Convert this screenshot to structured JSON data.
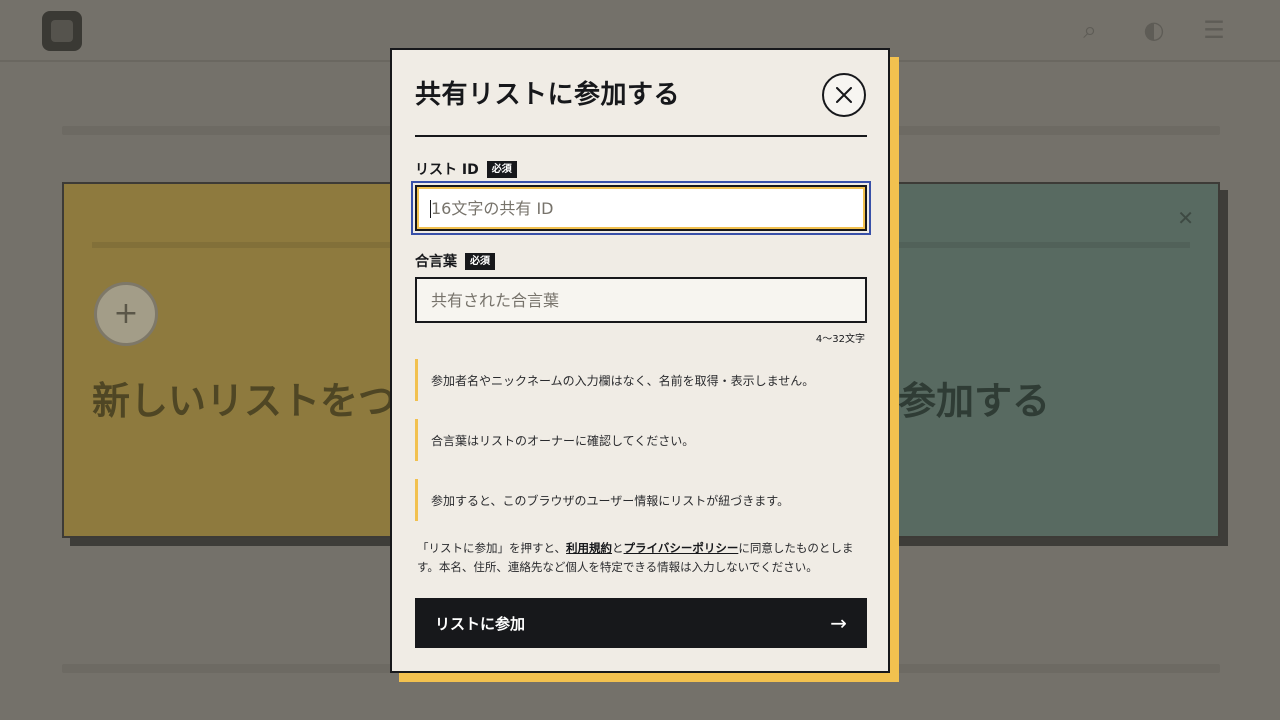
{
  "modal": {
    "title": "共有リストに参加する",
    "close_label": "閉じる",
    "list_id": {
      "label": "リスト ID",
      "required_badge": "必須",
      "placeholder": "16文字の共有 ID",
      "value": ""
    },
    "passphrase": {
      "label": "合言葉",
      "required_badge": "必須",
      "placeholder": "共有された合言葉",
      "value": "",
      "length_hint": "4〜32文字"
    },
    "notices": [
      "参加者名やニックネームの入力欄はなく、名前を取得・表示しません。",
      "合言葉はリストのオーナーに確認してください。",
      "参加すると、このブラウザのユーザー情報にリストが紐づきます。"
    ],
    "legal": {
      "prefix": "「リストに参加」を押すと、",
      "terms_link": "利用規約",
      "and": "と",
      "privacy_link": "プライバシーポリシー",
      "suffix": "に同意したものとします。本名、住所、連絡先など個人を特定できる情報は入力しないでください。"
    },
    "submit": {
      "label": "リストに参加",
      "arrow": "→"
    }
  },
  "background": {
    "card_left_title": "新しいリストをつく",
    "card_right_title": "参加する"
  },
  "colors": {
    "accent": "#f2c14f",
    "dark": "#17181b",
    "modal_bg": "#f0ece5",
    "focus": "#3850a8"
  }
}
